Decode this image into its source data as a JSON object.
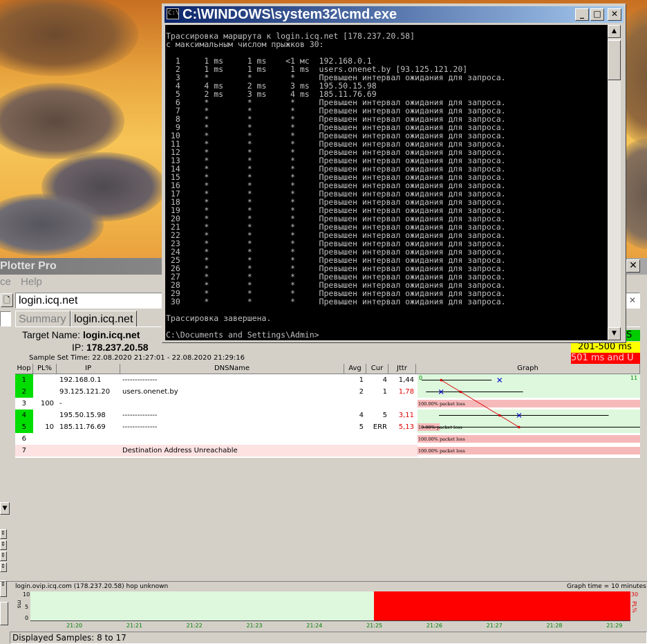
{
  "cmd": {
    "title": "C:\\WINDOWS\\system32\\cmd.exe",
    "icon": "cmd-icon",
    "lines": [
      "Трассировка маршрута к login.icq.net [178.237.20.58]",
      "с максимальным числом прыжков 30:",
      "",
      "  1     1 ms     1 ms    <1 мс  192.168.0.1",
      "  2     1 ms     1 ms     1 ms  users.onenet.by [93.125.121.20]",
      "  3     *        *        *     Превышен интервал ожидания для запроса.",
      "  4     4 ms     2 ms     3 ms  195.50.15.98",
      "  5     2 ms     3 ms     4 ms  185.11.76.69",
      "  6     *        *        *     Превышен интервал ожидания для запроса.",
      "  7     *        *        *     Превышен интервал ожидания для запроса.",
      "  8     *        *        *     Превышен интервал ожидания для запроса.",
      "  9     *        *        *     Превышен интервал ожидания для запроса.",
      " 10     *        *        *     Превышен интервал ожидания для запроса.",
      " 11     *        *        *     Превышен интервал ожидания для запроса.",
      " 12     *        *        *     Превышен интервал ожидания для запроса.",
      " 13     *        *        *     Превышен интервал ожидания для запроса.",
      " 14     *        *        *     Превышен интервал ожидания для запроса.",
      " 15     *        *        *     Превышен интервал ожидания для запроса.",
      " 16     *        *        *     Превышен интервал ожидания для запроса.",
      " 17     *        *        *     Превышен интервал ожидания для запроса.",
      " 18     *        *        *     Превышен интервал ожидания для запроса.",
      " 19     *        *        *     Превышен интервал ожидания для запроса.",
      " 20     *        *        *     Превышен интервал ожидания для запроса.",
      " 21     *        *        *     Превышен интервал ожидания для запроса.",
      " 22     *        *        *     Превышен интервал ожидания для запроса.",
      " 23     *        *        *     Превышен интервал ожидания для запроса.",
      " 24     *        *        *     Превышен интервал ожидания для запроса.",
      " 25     *        *        *     Превышен интервал ожидания для запроса.",
      " 26     *        *        *     Превышен интервал ожидания для запроса.",
      " 27     *        *        *     Превышен интервал ожидания для запроса.",
      " 28     *        *        *     Превышен интервал ожидания для запроса.",
      " 29     *        *        *     Превышен интервал ожидания для запроса.",
      " 30     *        *        *     Превышен интервал ожидания для запроса.",
      "",
      "Трассировка завершена.",
      "",
      "C:\\Documents and Settings\\Admin>"
    ]
  },
  "pp": {
    "title": "Plotter Pro",
    "menu": [
      "ce",
      "Help"
    ],
    "target_input": "login.icq.net",
    "tabs": [
      "Summary",
      "login.icq.net"
    ],
    "target_name_label": "Target Name:",
    "target_name": "login.icq.net",
    "ip_label": "IP:",
    "ip": "178.237.20.58",
    "sample_set_label": "Sample Set Time:",
    "sample_set": "22.08.2020 21:27:01 - 22.08.2020 21:29:16",
    "legend": [
      {
        "text": "S",
        "color": "#00cc00"
      },
      {
        "text": "201-500 ms",
        "color": "#ffff00"
      },
      {
        "text": "501 ms and U",
        "color": "#ff0000"
      }
    ],
    "columns": [
      "Hop",
      "PL%",
      "IP",
      "DNSName",
      "Avg",
      "Cur",
      "Jttr",
      "Graph"
    ],
    "graph_scale_left": "0",
    "graph_scale_right": "11",
    "rows": [
      {
        "hop": "1",
        "pl": "",
        "ip": "192.168.0.1",
        "dns": "--------------",
        "avg": "1",
        "cur": "4",
        "jttr": "1,44",
        "jttr_red": false,
        "hop_green": true,
        "loss": ""
      },
      {
        "hop": "2",
        "pl": "",
        "ip": "93.125.121.20",
        "dns": "users.onenet.by",
        "avg": "2",
        "cur": "1",
        "jttr": "1,78",
        "jttr_red": true,
        "hop_green": true,
        "loss": ""
      },
      {
        "hop": "3",
        "pl": "100",
        "ip": "-",
        "dns": "",
        "avg": "",
        "cur": "",
        "jttr": "",
        "jttr_red": false,
        "hop_green": false,
        "loss": "100.00% packet loss"
      },
      {
        "hop": "4",
        "pl": "",
        "ip": "195.50.15.98",
        "dns": "--------------",
        "avg": "4",
        "cur": "5",
        "jttr": "3,11",
        "jttr_red": true,
        "hop_green": true,
        "loss": ""
      },
      {
        "hop": "5",
        "pl": "10",
        "ip": "185.11.76.69",
        "dns": "--------------",
        "avg": "5",
        "cur": "ERR",
        "jttr": "5,13",
        "jttr_red": true,
        "hop_green": true,
        "loss": "10.00% packet loss"
      },
      {
        "hop": "6",
        "pl": "",
        "ip": "",
        "dns": "",
        "avg": "",
        "cur": "",
        "jttr": "",
        "jttr_red": false,
        "hop_green": false,
        "loss": "100.00% packet loss"
      },
      {
        "hop": "7",
        "pl": "",
        "ip": "",
        "dns": "Destination Address Unreachable",
        "avg": "",
        "cur": "",
        "jttr": "",
        "jttr_red": false,
        "hop_green": false,
        "loss": "100.00% packet loss"
      }
    ],
    "timeline": {
      "caption": "login.ovip.icq.com (178.237.20.58) hop unknown",
      "graph_time": "Graph time = 10 minutes",
      "ms_label": "ms",
      "pl_label": "PL%",
      "y_ticks": [
        "10",
        "5",
        "0"
      ],
      "pl_max": "30",
      "times": [
        "21:20",
        "21:21",
        "21:22",
        "21:23",
        "21:24",
        "21:25",
        "21:26",
        "21:27",
        "21:28",
        "21:29"
      ],
      "loss_start_fraction": 0.573
    },
    "status": "Displayed Samples: 8 to 17"
  }
}
